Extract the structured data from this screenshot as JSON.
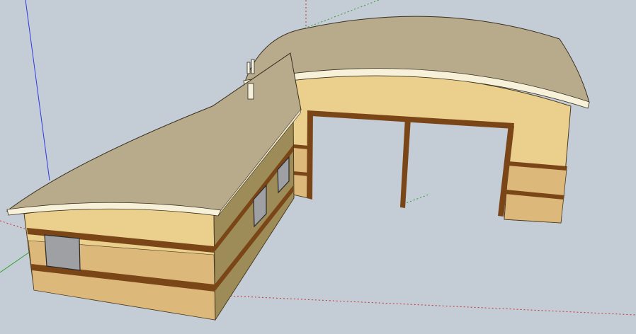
{
  "viewport": {
    "background": "#c4ccd6"
  },
  "colors": {
    "roof": "#b8ab8c",
    "roof_edge": "#f6f1d8",
    "wall_upper": "#ead08c",
    "wall_lower": "#dcb97a",
    "wall_shade": "#9d8c58",
    "trim": "#7a4617",
    "window": "#9ea0a4",
    "axis_red": "#c83232",
    "axis_green": "#2ea02e",
    "axis_blue": "#2f3ae0"
  },
  "axes": [
    "red-axis",
    "green-axis",
    "blue-axis"
  ],
  "model": {
    "parts": [
      "left-wing",
      "right-wing",
      "garage-door-opening",
      "chimney-vent"
    ]
  }
}
